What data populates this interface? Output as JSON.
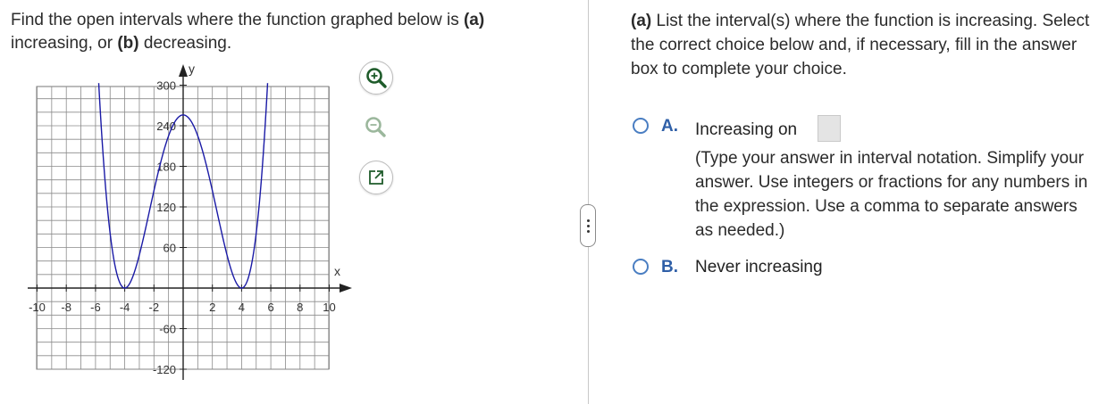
{
  "question": {
    "part1": "Find the open intervals where the function graphed below is ",
    "a_label": "(a)",
    "part2": "increasing, or ",
    "b_label": "(b)",
    "part3": " decreasing."
  },
  "graph": {
    "y_axis_label": "y",
    "x_axis_label": "x",
    "x_ticks": [
      "-10",
      "-8",
      "-6",
      "-4",
      "-2",
      "2",
      "4",
      "6",
      "8",
      "10"
    ],
    "y_ticks": [
      "300",
      "240",
      "180",
      "120",
      "60",
      "-60",
      "-120"
    ],
    "curve_color": "#1a1aa6",
    "x_range": [
      -10,
      10
    ],
    "y_range": [
      -120,
      300
    ],
    "key_points": [
      [
        -4,
        0
      ],
      [
        0,
        256
      ],
      [
        4,
        0
      ]
    ]
  },
  "tools": {
    "zoom_in": "zoom-in-icon",
    "zoom_out": "zoom-out-icon",
    "popout": "popout-icon"
  },
  "prompt": {
    "a_label": "(a)",
    "text": " List the interval(s) where the function is increasing. Select the correct choice below and, if necessary, fill in the answer box to complete your choice."
  },
  "choices": {
    "a": {
      "letter": "A.",
      "text": "Increasing on",
      "hint": "(Type your answer in interval notation. Simplify your answer. Use integers or fractions for any numbers in the expression. Use a comma to separate answers as needed.)",
      "answer_value": ""
    },
    "b": {
      "letter": "B.",
      "text": "Never increasing"
    }
  }
}
